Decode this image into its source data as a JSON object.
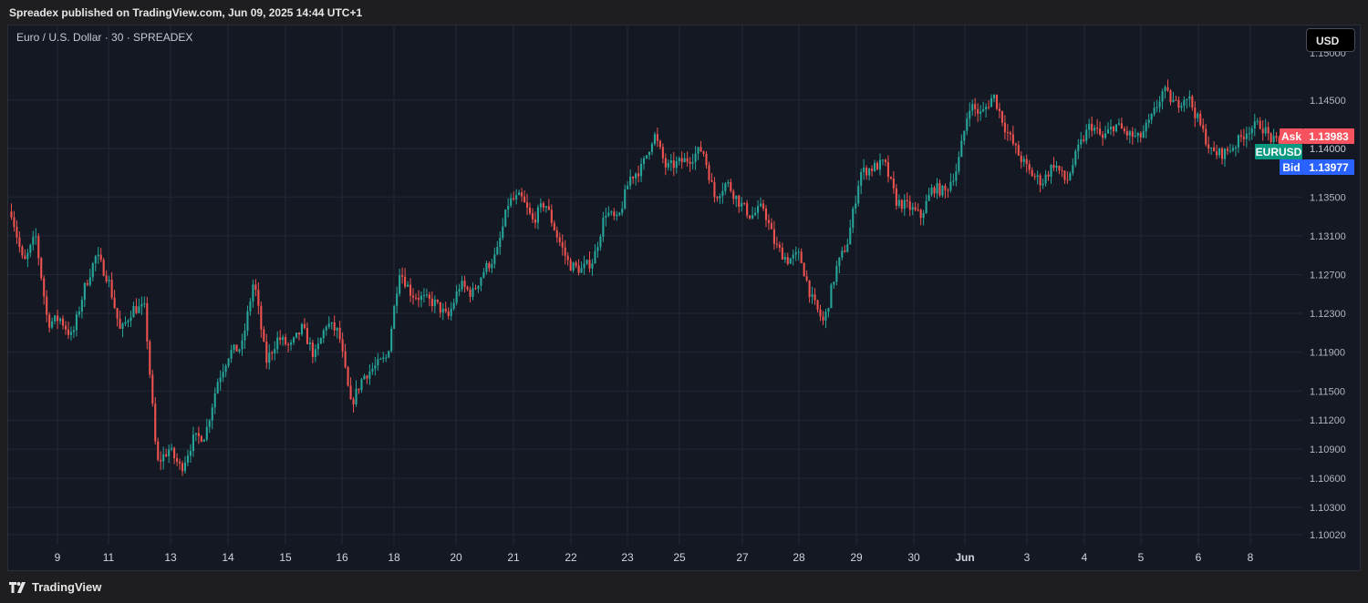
{
  "publisher": "Spreadex published on TradingView.com, Jun 09, 2025 14:44 UTC+1",
  "symbol_title": "Euro / U.S. Dollar · 30 · SPREADEX",
  "currency": "USD",
  "footer": {
    "logo_text": "TradingView"
  },
  "colors": {
    "up": "#26a69a",
    "down": "#ef5350",
    "background": "#141823",
    "grid": "#232634",
    "ask": "#f7525f",
    "bid": "#2962ff",
    "symbol_tag": "#089981"
  },
  "chart_data": {
    "type": "candlestick",
    "symbol": "EURUSD",
    "interval": "30",
    "ylim": [
      1.099,
      1.1505
    ],
    "y_ticks": [
      "1.14500",
      "1.14000",
      "1.13500",
      "1.13100",
      "1.12700",
      "1.12300",
      "1.11900",
      "1.11500",
      "1.11200",
      "1.10900",
      "1.10600",
      "1.10300",
      "1.10020"
    ],
    "x_ticks": [
      "9",
      "11",
      "13",
      "14",
      "15",
      "16",
      "18",
      "20",
      "21",
      "22",
      "23",
      "25",
      "27",
      "28",
      "29",
      "30",
      "Jun",
      "3",
      "4",
      "5",
      "6",
      "8"
    ],
    "price_path": [
      1.1335,
      1.128,
      1.131,
      1.122,
      1.1225,
      1.1205,
      1.1255,
      1.129,
      1.1265,
      1.121,
      1.1235,
      1.1235,
      1.1075,
      1.109,
      1.107,
      1.11,
      1.1105,
      1.116,
      1.119,
      1.1195,
      1.1265,
      1.118,
      1.1205,
      1.1195,
      1.1215,
      1.1185,
      1.122,
      1.121,
      1.1135,
      1.1165,
      1.1175,
      1.1185,
      1.1275,
      1.125,
      1.1245,
      1.124,
      1.1225,
      1.126,
      1.125,
      1.1275,
      1.129,
      1.1345,
      1.135,
      1.1325,
      1.1345,
      1.131,
      1.128,
      1.1275,
      1.1285,
      1.1335,
      1.1325,
      1.137,
      1.138,
      1.1415,
      1.138,
      1.1385,
      1.139,
      1.14,
      1.135,
      1.1365,
      1.1345,
      1.133,
      1.134,
      1.13,
      1.1285,
      1.129,
      1.1245,
      1.122,
      1.1275,
      1.1305,
      1.1375,
      1.138,
      1.1385,
      1.1345,
      1.134,
      1.133,
      1.136,
      1.1355,
      1.138,
      1.1445,
      1.1435,
      1.1455,
      1.142,
      1.1395,
      1.1375,
      1.1365,
      1.1385,
      1.1365,
      1.14,
      1.1425,
      1.141,
      1.1425,
      1.1415,
      1.141,
      1.143,
      1.146,
      1.1445,
      1.1455,
      1.1425,
      1.1395,
      1.1395,
      1.1405,
      1.142,
      1.1425,
      1.1408,
      1.14
    ],
    "ask": {
      "label": "Ask",
      "value": "1.13983"
    },
    "bid": {
      "label": "Bid",
      "value": "1.13977"
    },
    "symbol_tag": "EURUSD",
    "last_price_label": "1.14000",
    "top_partial_tick": "1.15000"
  }
}
